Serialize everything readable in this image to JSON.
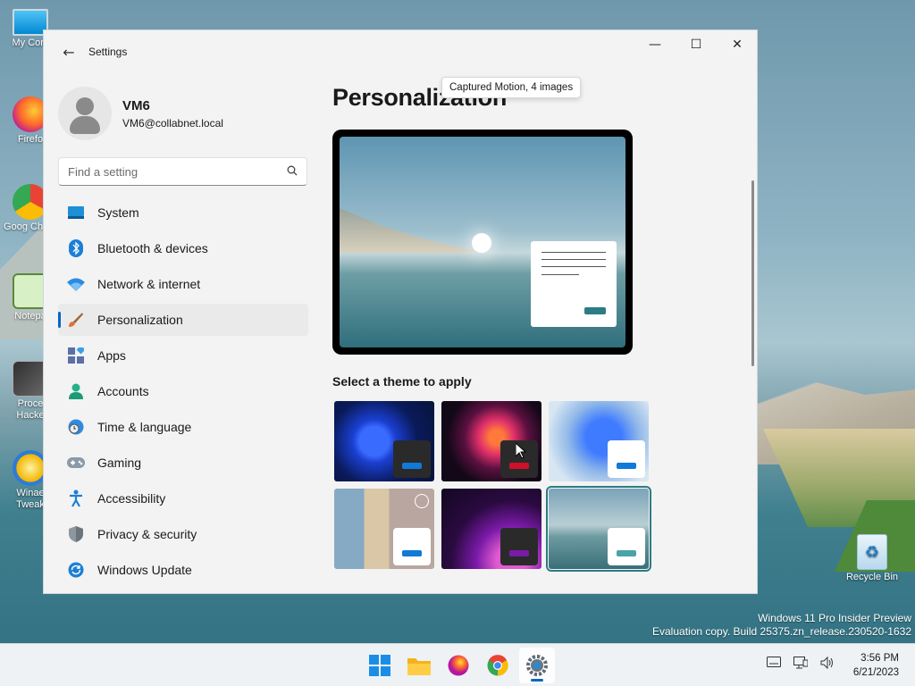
{
  "desktop": {
    "icons": [
      {
        "label": "My Com"
      },
      {
        "label": "Firefo"
      },
      {
        "label": "Goog Chron"
      },
      {
        "label": "Notepa"
      },
      {
        "label": "Proce Hacke"
      },
      {
        "label": "Winae Tweak"
      }
    ],
    "recycle_bin": {
      "label": "Recycle Bin"
    },
    "watermark": {
      "line1": "Windows 11 Pro Insider Preview",
      "line2": "Evaluation copy. Build 25375.zn_release.230520-1632"
    }
  },
  "window": {
    "title": "Settings",
    "controls": {
      "minimize": "—",
      "maximize": "☐",
      "close": "✕"
    }
  },
  "profile": {
    "name": "VM6",
    "email": "VM6@collabnet.local"
  },
  "search": {
    "placeholder": "Find a setting"
  },
  "nav": {
    "items": [
      {
        "label": "System",
        "icon": "system-icon"
      },
      {
        "label": "Bluetooth & devices",
        "icon": "bluetooth-icon"
      },
      {
        "label": "Network & internet",
        "icon": "wifi-icon"
      },
      {
        "label": "Personalization",
        "icon": "brush-icon",
        "active": true
      },
      {
        "label": "Apps",
        "icon": "apps-icon"
      },
      {
        "label": "Accounts",
        "icon": "accounts-icon"
      },
      {
        "label": "Time & language",
        "icon": "globe-clock-icon"
      },
      {
        "label": "Gaming",
        "icon": "gamepad-icon"
      },
      {
        "label": "Accessibility",
        "icon": "accessibility-icon"
      },
      {
        "label": "Privacy & security",
        "icon": "shield-icon"
      },
      {
        "label": "Windows Update",
        "icon": "update-icon"
      }
    ]
  },
  "main": {
    "title": "Personalization",
    "themes_label": "Select a theme to apply",
    "tooltip": "Captured Motion, 4 images",
    "selected_theme_index": 5
  },
  "colors": {
    "accent": "#0067c0",
    "selected_theme": "#2b7c84"
  },
  "taskbar": {
    "apps": [
      "start-icon",
      "file-explorer-icon",
      "firefox-icon",
      "chrome-icon",
      "settings-icon"
    ],
    "tray": [
      "keyboard-icon",
      "network-icon",
      "volume-icon"
    ],
    "time": "3:56 PM",
    "date": "6/21/2023"
  }
}
